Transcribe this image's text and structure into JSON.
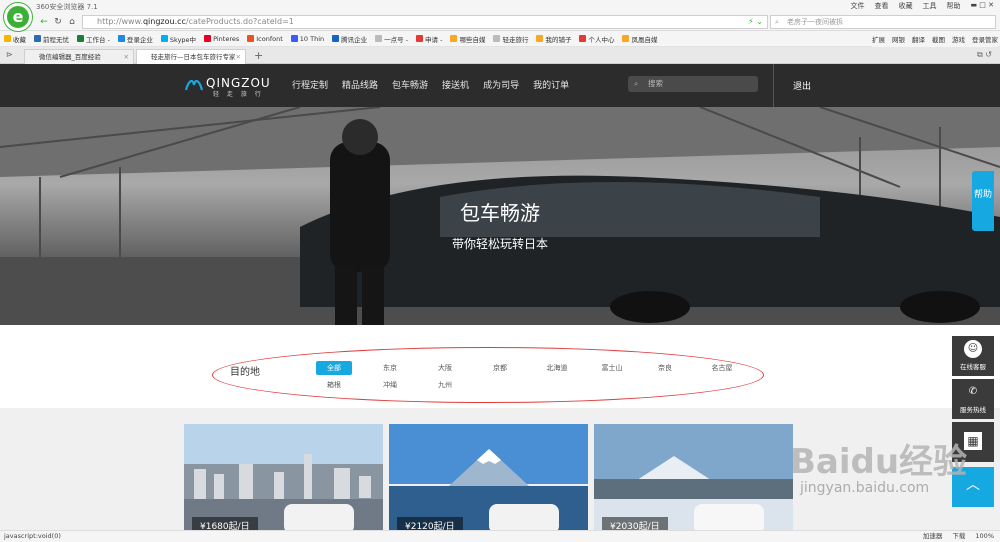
{
  "browser": {
    "app_title": "360安全浏览器 7.1",
    "menu": [
      "文件",
      "查看",
      "收藏",
      "工具",
      "帮助"
    ],
    "url_prefix": "http://www.",
    "url_host": "qingzou.cc",
    "url_path": "/cateProducts.do?cateId=1",
    "search_text": "老房子一夜间被拆",
    "bookmarks": [
      "收藏",
      "前程无忧",
      "工作台 -",
      "登录企业",
      "Skype中",
      "Pinteres",
      "Iconfont",
      "10 Thin",
      "腾讯企业",
      "一点号 -",
      "申请 -",
      "哪些自媒",
      "轻走旅行",
      "我的铺子",
      "个人中心",
      "凤凰自媒"
    ],
    "bookmarks_right": [
      "扩展",
      "网银",
      "翻译",
      "截图",
      "游戏",
      "登录管家"
    ],
    "tabs": [
      {
        "title": "微信编辑器_百度经验"
      },
      {
        "title": "轻走旅行—日本包车旅行专家"
      }
    ],
    "new_tab": "+"
  },
  "site": {
    "brand": "QINGZOU",
    "brand_sub": "轻 走 旅 行",
    "nav": [
      "行程定制",
      "精品线路",
      "包车畅游",
      "接送机",
      "成为司导",
      "我的订单"
    ],
    "search_placeholder": "搜索",
    "logout": "退出"
  },
  "banner": {
    "title": "包车畅游",
    "subtitle": "带你轻松玩转日本",
    "help": "帮助"
  },
  "filter": {
    "label": "目的地",
    "row1": [
      "全部",
      "东京",
      "大阪",
      "京都",
      "北海道",
      "富士山",
      "奈良",
      "名古屋"
    ],
    "row2": [
      "箱根",
      "冲绳",
      "九州"
    ]
  },
  "cards": [
    {
      "price": "¥1680起/日"
    },
    {
      "price": "¥2120起/日"
    },
    {
      "price": "¥2030起/日"
    }
  ],
  "side": {
    "service": "在线客服",
    "hotline": "服务热线",
    "top": "︿"
  },
  "watermark": {
    "text": "Baidu经验",
    "url": "jingyan.baidu.com"
  },
  "status": {
    "left": "javascript:void(0)",
    "right": [
      "加速器",
      "下载"
    ],
    "zoom": "100%"
  }
}
